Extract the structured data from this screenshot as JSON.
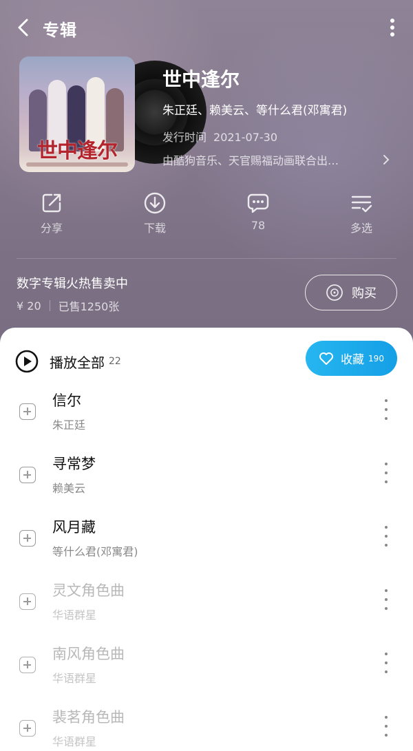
{
  "header": {
    "title": "专辑"
  },
  "album": {
    "cover_text": "世中逢尔",
    "name": "世中逢尔",
    "artists": "朱正廷、赖美云、等什么君(邓寓君)",
    "release_label": "发行时间",
    "release_date": "2021-07-30",
    "publisher": "由酷狗音乐、天官赐福动画联合出…"
  },
  "actions": [
    {
      "label": "分享",
      "icon": "share-icon"
    },
    {
      "label": "下载",
      "icon": "download-icon"
    },
    {
      "label": "78",
      "icon": "comment-icon"
    },
    {
      "label": "多选",
      "icon": "multi-select-icon"
    }
  ],
  "promo": {
    "title": "数字专辑火热售卖中",
    "price": "¥ 20",
    "sold": "已售1250张",
    "buy_label": "购买"
  },
  "list": {
    "play_all_label": "播放全部",
    "count": "22",
    "fav_label": "收藏",
    "fav_count": "190"
  },
  "songs": [
    {
      "name": "信尔",
      "artist": "朱正廷",
      "available": true
    },
    {
      "name": "寻常梦",
      "artist": "赖美云",
      "available": true
    },
    {
      "name": "风月藏",
      "artist": "等什么君(邓寓君)",
      "available": true
    },
    {
      "name": "灵文角色曲",
      "artist": "华语群星",
      "available": false
    },
    {
      "name": "南风角色曲",
      "artist": "华语群星",
      "available": false
    },
    {
      "name": "裴茗角色曲",
      "artist": "华语群星",
      "available": false
    }
  ],
  "colors": {
    "accent": "#159fe6",
    "hero_bg": "#85798d"
  }
}
